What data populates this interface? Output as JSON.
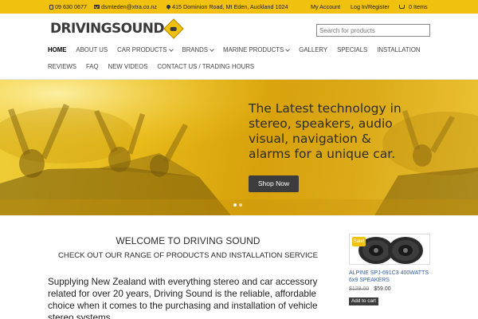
{
  "topbar": {
    "phone": "09 630 0677",
    "email": "dsmteden@xtra.co.nz",
    "address": "415 Dominion Road, Mt Eden, Auckland 1024",
    "my_account": "My Account",
    "login": "Log In/Register",
    "cart": "0 Items",
    "icons": [
      "phone-icon",
      "mail-icon",
      "map-pin-icon",
      "cart-icon"
    ]
  },
  "header": {
    "logo_text": "DRIVINGSOUND",
    "search_placeholder": "Search for products"
  },
  "nav": {
    "row1": [
      {
        "label": "HOME",
        "active": true,
        "dropdown": false
      },
      {
        "label": "ABOUT US",
        "active": false,
        "dropdown": false
      },
      {
        "label": "CAR PRODUCTS",
        "active": false,
        "dropdown": true
      },
      {
        "label": "BRANDS",
        "active": false,
        "dropdown": true
      },
      {
        "label": "MARINE PRODUCTS",
        "active": false,
        "dropdown": true
      },
      {
        "label": "GALLERY",
        "active": false,
        "dropdown": false
      },
      {
        "label": "SPECIALS",
        "active": false,
        "dropdown": false
      },
      {
        "label": "INSTALLATION",
        "active": false,
        "dropdown": false
      }
    ],
    "row2": [
      {
        "label": "REVIEWS"
      },
      {
        "label": "FAQ"
      },
      {
        "label": "NEW VIDEOS"
      },
      {
        "label": "CONTACT US / TRADING HOURS"
      }
    ]
  },
  "hero": {
    "headline": "The Latest technology in stereo, speakers, audio visual, navigation & alarms for a unique car.",
    "button": "Shop Now",
    "slides": 2,
    "active_slide": 1
  },
  "content": {
    "welcome": "WELCOME TO DRIVING SOUND",
    "subheading": "CHECK OUT OUR RANGE OF PRODUCTS AND INSTALLATION SERVICE",
    "body": "Supplying New Zealand with everything stereo and car accessory related for over 20 years, Driving Sound is the reliable, affordable choice when it comes to the purchasing and installation of vehicle stereo systems."
  },
  "product": {
    "badge": "Sale!",
    "name": "ALPINE SPJ-691C3 400WATTS 6x9 SPEAKERS",
    "old_price": "$129.00",
    "price": "$59.00",
    "add_to_cart": "Add to cart"
  },
  "colors": {
    "accent": "#f0c10f",
    "dark_button": "#3c3c3c",
    "link_blue": "#2f5fa8"
  }
}
